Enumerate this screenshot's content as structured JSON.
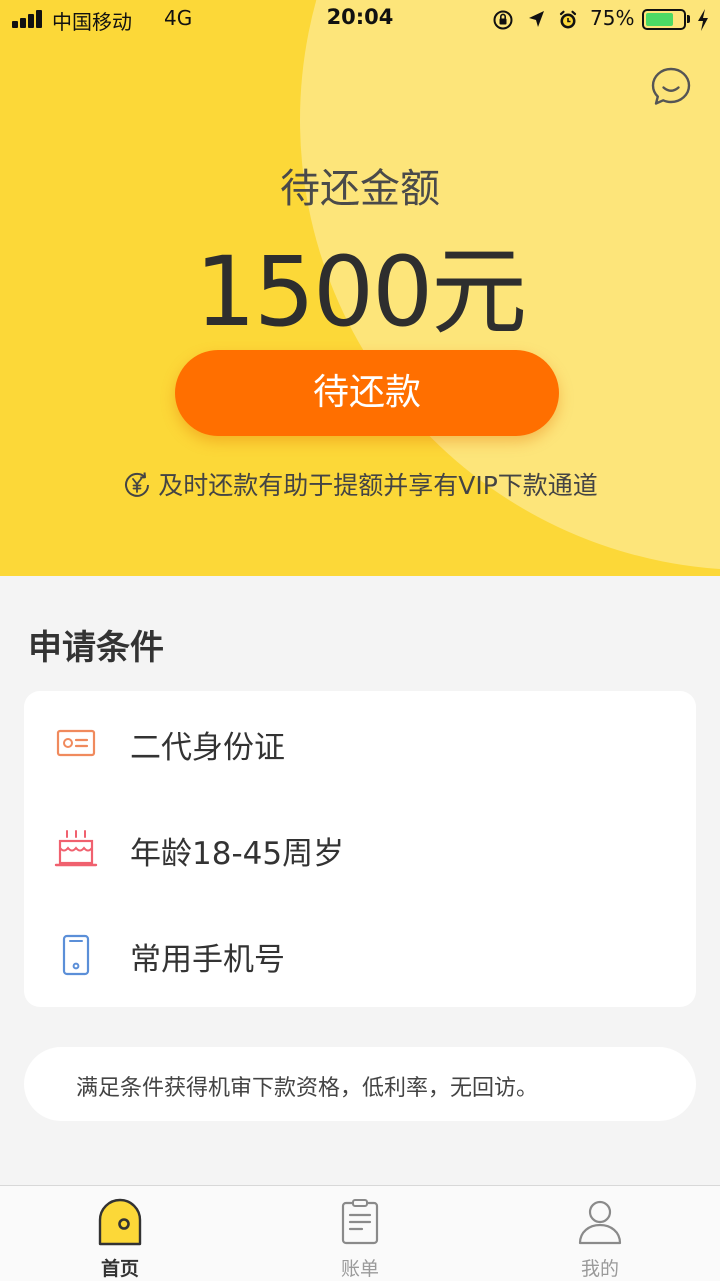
{
  "status_bar": {
    "carrier": "中国移动",
    "network": "4G",
    "time": "20:04",
    "battery_percent": "75%",
    "battery_level": 0.75
  },
  "hero": {
    "amount_label": "待还金额",
    "amount_value": "1500元",
    "repay_button": "待还款",
    "tip": "及时还款有助于提额并享有VIP下款通道"
  },
  "conditions": {
    "title": "申请条件",
    "items": [
      {
        "label": "二代身份证",
        "icon": "id-card-icon"
      },
      {
        "label": "年龄18-45周岁",
        "icon": "birthday-cake-icon"
      },
      {
        "label": "常用手机号",
        "icon": "mobile-phone-icon"
      }
    ],
    "note": "满足条件获得机审下款资格，低利率，无回访。"
  },
  "tabbar": {
    "tabs": [
      {
        "label": "首页",
        "icon": "home-icon",
        "active": true
      },
      {
        "label": "账单",
        "icon": "bill-icon",
        "active": false
      },
      {
        "label": "我的",
        "icon": "user-icon",
        "active": false
      }
    ]
  },
  "colors": {
    "hero_bg": "#fcd838",
    "hero_circle": "#fde57a",
    "button": "#ff6f00",
    "tab_active_yellow": "#fcd838"
  }
}
